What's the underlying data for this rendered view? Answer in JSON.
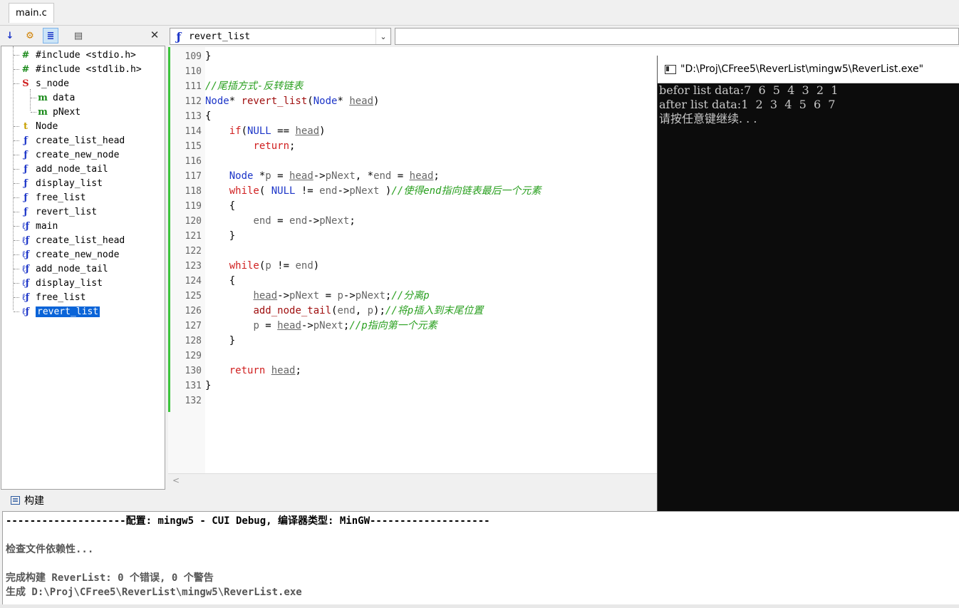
{
  "tab": {
    "label": "main.c"
  },
  "function_combo": {
    "value": "revert_list"
  },
  "tree": {
    "items": [
      {
        "icon": "#",
        "color": "#1a8a1a",
        "label": "#include <stdio.h>"
      },
      {
        "icon": "#",
        "color": "#1a8a1a",
        "label": "#include <stdlib.h>"
      },
      {
        "icon": "S",
        "color": "#d02020",
        "label": "s_node"
      },
      {
        "icon": "m",
        "color": "#1a8a1a",
        "label": "data"
      },
      {
        "icon": "m",
        "color": "#1a8a1a",
        "label": "pNext"
      },
      {
        "icon": "t",
        "color": "#c8a000",
        "label": "Node"
      },
      {
        "icon": "f",
        "color": "#1c35c8",
        "label": "create_list_head"
      },
      {
        "icon": "f",
        "color": "#1c35c8",
        "label": "create_new_node"
      },
      {
        "icon": "f",
        "color": "#1c35c8",
        "label": "add_node_tail"
      },
      {
        "icon": "f",
        "color": "#1c35c8",
        "label": "display_list"
      },
      {
        "icon": "f",
        "color": "#1c35c8",
        "label": "free_list"
      },
      {
        "icon": "f",
        "color": "#1c35c8",
        "label": "revert_list"
      },
      {
        "icon": "lf",
        "color": "#1c35c8",
        "label": "main"
      },
      {
        "icon": "lf",
        "color": "#1c35c8",
        "label": "create_list_head"
      },
      {
        "icon": "lf",
        "color": "#1c35c8",
        "label": "create_new_node"
      },
      {
        "icon": "lf",
        "color": "#1c35c8",
        "label": "add_node_tail"
      },
      {
        "icon": "lf",
        "color": "#1c35c8",
        "label": "display_list"
      },
      {
        "icon": "lf",
        "color": "#1c35c8",
        "label": "free_list"
      },
      {
        "icon": "lf",
        "color": "#1c35c8",
        "label": "revert_list"
      }
    ]
  },
  "code": {
    "line_numbers": [
      "109",
      "110",
      "111",
      "112",
      "113",
      "114",
      "115",
      "116",
      "117",
      "118",
      "119",
      "120",
      "121",
      "122",
      "123",
      "124",
      "125",
      "126",
      "127",
      "128",
      "129",
      "130",
      "131",
      "132"
    ],
    "comments": {
      "c111": "//尾插方式-反转链表",
      "c118": "//使得end指向链表最后一个元素",
      "c125": "//分离p",
      "c126": "//将p插入到末尾位置",
      "c127": "//p指向第一个元素"
    }
  },
  "console": {
    "title": "\"D:\\Proj\\CFree5\\ReverList\\mingw5\\ReverList.exe\"",
    "lines": [
      "befor list data:7  6  5  4  3  2  1",
      "after list data:1  2  3  4  5  6  7",
      "请按任意键继续. . ."
    ]
  },
  "build": {
    "header": "构建",
    "lines": [
      "--------------------配置: mingw5 - CUI Debug, 编译器类型: MinGW--------------------",
      "",
      "检查文件依赖性...",
      "",
      "完成构建 ReverList: 0 个错误, 0 个警告",
      "生成 D:\\Proj\\CFree5\\ReverList\\mingw5\\ReverList.exe"
    ]
  }
}
